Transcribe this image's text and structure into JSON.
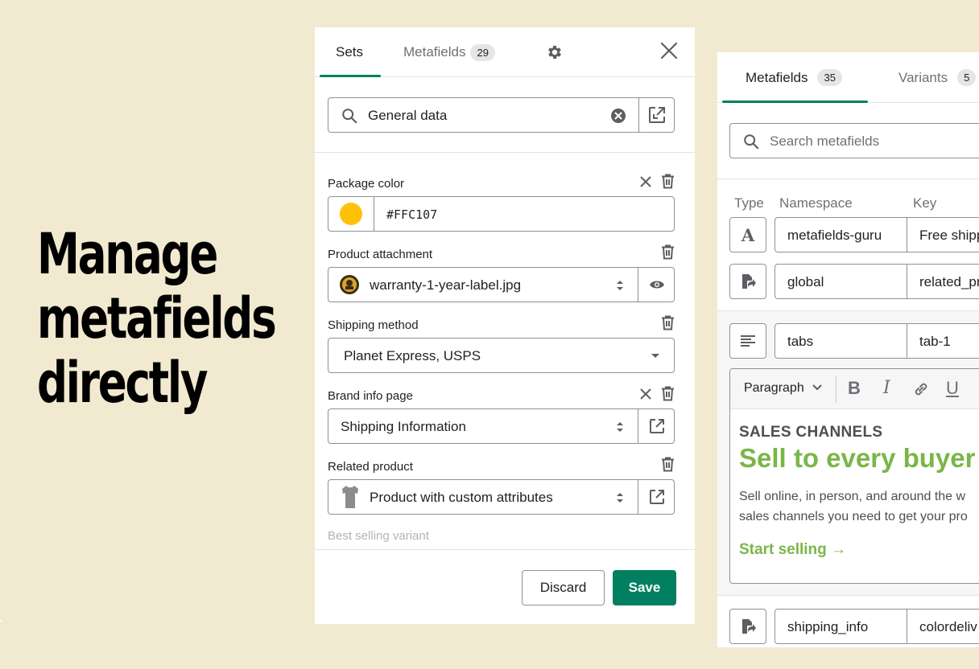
{
  "headline": [
    "Manage",
    "metafields",
    "directly"
  ],
  "left_panel": {
    "tabs": [
      {
        "label": "Sets",
        "active": true
      },
      {
        "label": "Metafields",
        "badge": "29",
        "active": false
      }
    ],
    "search": {
      "value": "General data"
    },
    "fields": [
      {
        "label": "Package color",
        "value": "#FFC107",
        "swatch": "#FFC107",
        "actions": [
          "clear",
          "delete"
        ]
      },
      {
        "label": "Product attachment",
        "value": "warranty-1-year-label.jpg",
        "actions": [
          "delete"
        ],
        "side_icon": "eye-icon"
      },
      {
        "label": "Shipping method",
        "value": "Planet Express, USPS",
        "actions": [
          "delete"
        ]
      },
      {
        "label": "Brand info page",
        "value": "Shipping Information",
        "actions": [
          "clear",
          "delete"
        ],
        "side_icon": "external-link-icon"
      },
      {
        "label": "Related product",
        "value": "Product with custom attributes",
        "actions": [
          "delete"
        ],
        "side_icon": "external-link-icon"
      }
    ],
    "faded_label": "Best selling variant",
    "footer": {
      "discard_label": "Discard",
      "save_label": "Save"
    }
  },
  "right_panel": {
    "tabs": [
      {
        "label": "Metafields",
        "badge": "35",
        "active": true
      },
      {
        "label": "Variants",
        "badge": "5",
        "active": false
      }
    ],
    "search_placeholder": "Search metafields",
    "columns": [
      "Type",
      "Namespace",
      "Key"
    ],
    "rows": [
      {
        "type_icon": "text-type-icon",
        "namespace": "metafields-guru",
        "key": "Free shipp"
      },
      {
        "type_icon": "reference-type-icon",
        "namespace": "global",
        "key": "related_pr"
      },
      {
        "type_icon": "rich-text-type-icon",
        "namespace": "tabs",
        "key": "tab-1"
      },
      {
        "type_icon": "reference-type-icon",
        "namespace": "shipping_info",
        "key": "colordeliv"
      }
    ],
    "editor": {
      "format_label": "Paragraph",
      "toolbar": [
        "B",
        "I",
        "link",
        "U"
      ],
      "kicker": "SALES CHANNELS",
      "heading": "Sell to every buyer",
      "body_line1": "Sell online, in person, and around the w",
      "body_line2": "sales channels you need to get your pro",
      "link": "Start selling →"
    }
  },
  "colors": {
    "background": "#f2ead0",
    "primary": "#008060",
    "accent_green": "#7ab648",
    "swatch": "#FFC107"
  }
}
